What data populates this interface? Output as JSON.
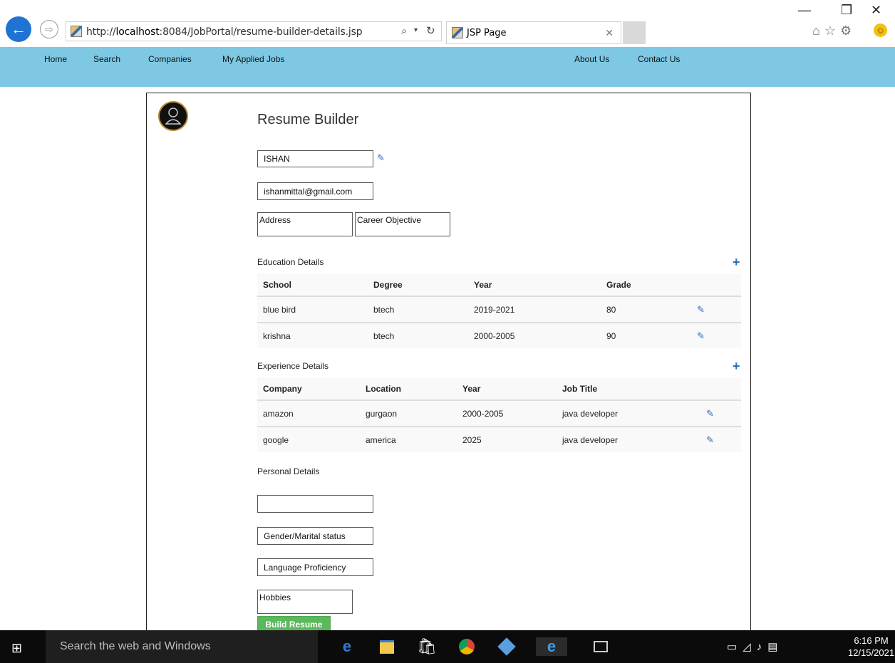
{
  "browser": {
    "url_prefix": "http://",
    "url_host": "localhost",
    "url_rest": ":8084/JobPortal/resume-builder-details.jsp",
    "tab_title": "JSP Page",
    "back_glyph": "←",
    "forward_glyph": "⇨",
    "search_glyph": "⌕",
    "dropdown_glyph": "▾",
    "refresh_glyph": "↻",
    "close_glyph": "✕",
    "minimize_glyph": "—",
    "restore_glyph": "❐",
    "window_close_glyph": "✕",
    "toolbar_glyphs": "⌂☆⚙"
  },
  "nav": {
    "home": "Home",
    "search": "Search",
    "companies": "Companies",
    "applied": "My Applied Jobs",
    "about": "About Us",
    "contact": "Contact Us"
  },
  "resume": {
    "title": "Resume Builder",
    "name": "ISHAN",
    "email": "ishanmittal@gmail.com",
    "address_placeholder": "Address",
    "objective_placeholder": "Career Objective",
    "pencil_glyph": "✎",
    "plus_glyph": "+"
  },
  "education": {
    "label": "Education Details",
    "headers": [
      "School",
      "Degree",
      "Year",
      "Grade"
    ],
    "rows": [
      [
        "blue bird",
        "btech",
        "2019-2021",
        "80"
      ],
      [
        "krishna",
        "btech",
        "2000-2005",
        "90"
      ]
    ]
  },
  "experience": {
    "label": "Experience Details",
    "headers": [
      "Company",
      "Location",
      "Year",
      "Job Title"
    ],
    "rows": [
      [
        "amazon",
        "gurgaon",
        "2000-2005",
        "java developer"
      ],
      [
        "google",
        "america",
        "2025",
        "java developer"
      ]
    ]
  },
  "personal": {
    "label": "Personal Details",
    "dob_value": "",
    "gender_placeholder": "Gender/Marital status",
    "language_placeholder": "Language Proficiency",
    "hobbies_placeholder": "Hobbies"
  },
  "build_button": "Build Resume",
  "taskbar": {
    "search_placeholder": "Search the web and Windows",
    "time": "6:16 PM",
    "date": "12/15/2021",
    "start_glyph": "⊞",
    "tray_glyphs": "▭◿♪▤"
  },
  "colors": {
    "nav_bg": "#7ec8e3",
    "accent": "#2f6fb5",
    "build_btn": "#5cb85c"
  }
}
